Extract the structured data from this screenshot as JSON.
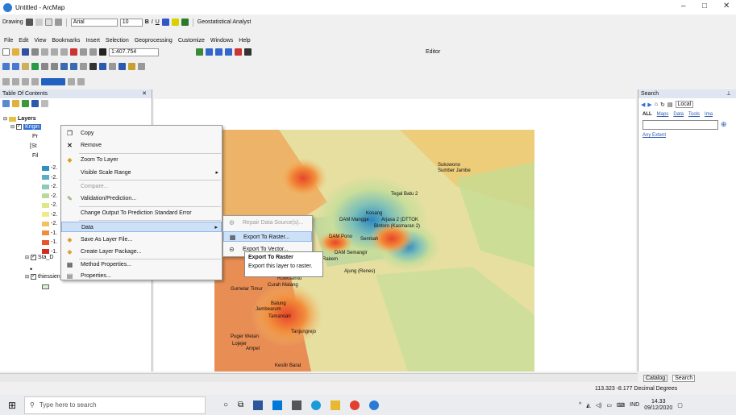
{
  "window": {
    "title": "Untitled - ArcMap",
    "min": "–",
    "max": "□",
    "close": "✕"
  },
  "toolbar1": {
    "drawing": "Drawing",
    "font": "Arial",
    "size": "10",
    "bold": "B",
    "italic": "I",
    "underline": "U",
    "geostat": "Geostatistical Analyst"
  },
  "menu": [
    "File",
    "Edit",
    "View",
    "Bookmarks",
    "Insert",
    "Selection",
    "Geoprocessing",
    "Customize",
    "Windows",
    "Help"
  ],
  "toolbar2": {
    "scale": "1:407.754",
    "editor": "Editor"
  },
  "toc": {
    "title": "Table Of Contents",
    "pin": "✕",
    "layers_label": "Layers",
    "kriging_label": "Krigin",
    "pr": "Pr",
    "st": "[St",
    "fil": "Fil",
    "sta_layer": "Sta_D",
    "thiessen": "thiessien_das",
    "legend": [
      {
        "t": "-2.",
        "c": "#2f8fc0"
      },
      {
        "t": "-2.",
        "c": "#5aaec4"
      },
      {
        "t": "-2.",
        "c": "#8cc9b8"
      },
      {
        "t": "-2.",
        "c": "#b8d99c"
      },
      {
        "t": "-2.",
        "c": "#dce88a"
      },
      {
        "t": "-2.",
        "c": "#f2e88a"
      },
      {
        "t": "-2.",
        "c": "#f4c060"
      },
      {
        "t": "-1.",
        "c": "#f28c3a"
      },
      {
        "t": "-1.",
        "c": "#e8552a"
      },
      {
        "t": "-1.",
        "c": "#d42a1e"
      }
    ]
  },
  "context_menu": {
    "copy": "Copy",
    "remove": "Remove",
    "zoom": "Zoom To Layer",
    "visible": "Visible Scale Range",
    "compare": "Compare...",
    "validation": "Validation/Prediction...",
    "change": "Change Output To Prediction Standard Error",
    "data": "Data",
    "save": "Save As Layer File...",
    "package": "Create Layer Package...",
    "method": "Method Properties...",
    "properties": "Properties..."
  },
  "submenu": {
    "repair": "Repair Data Source(s)...",
    "export_raster": "Export To Raster...",
    "export_vector": "Export To Vector..."
  },
  "tooltip": {
    "title": "Export To Raster",
    "body": "Export this layer to raster."
  },
  "map_labels": [
    "Sukowono",
    "Sumber Jambe",
    "Tegal Batu 2",
    "Kosang",
    "DAM Mangge",
    "Arjasa 2 (DTTOK",
    "Bintoro (Kasmaran 2)",
    "DAM Pono",
    "Sembah",
    "DAM Semangir",
    "Rakem",
    "Ajung (Renes)",
    "Rowotamtu",
    "Curah Malang",
    "Gumelar Timur",
    "Balung",
    "Jambearum",
    "Tamansari",
    "Tanjungrejo",
    "Puger Wetan",
    "Lojejer",
    "Ampel",
    "Kesilir Barat"
  ],
  "search": {
    "title": "Search",
    "local": "Local",
    "filters": [
      "ALL",
      "Maps",
      "Data",
      "Tools",
      "Ima"
    ],
    "extent": "Any Extent"
  },
  "status": {
    "coords": "113.323  -8.177 Decimal Degrees"
  },
  "tabs": {
    "catalog": "Catalog",
    "search": "Search"
  },
  "taskbar": {
    "search_placeholder": "Type here to search",
    "time": "14.33",
    "date": "09/12/2020",
    "lang": "IND"
  }
}
